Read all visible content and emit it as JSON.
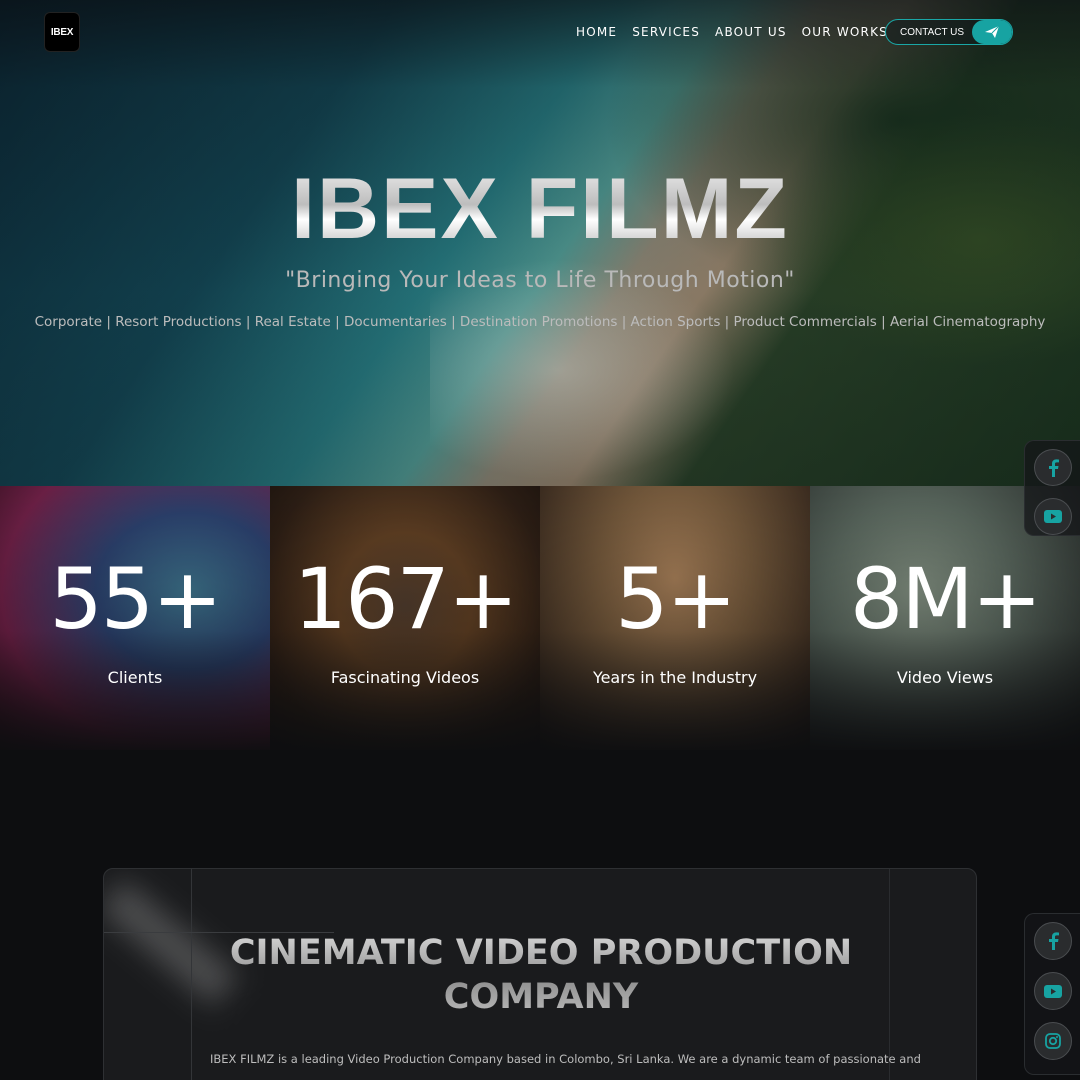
{
  "header": {
    "logo_text": "IBEX",
    "nav": [
      "HOME",
      "SERVICES",
      "ABOUT US",
      "OUR WORKS"
    ],
    "contact_label": "CONTACT US"
  },
  "hero": {
    "title": "IBEX FILMZ",
    "tagline": "\"Bringing Your Ideas to Life Through Motion\"",
    "services": "Corporate | Resort Productions | Real Estate | Documentaries | Destination Promotions | Action Sports | Product Commercials | Aerial Cinematography"
  },
  "stats": [
    {
      "value": "55+",
      "label": "Clients"
    },
    {
      "value": "167+",
      "label": "Fascinating Videos"
    },
    {
      "value": "5+",
      "label": "Years in the Industry"
    },
    {
      "value": "8M+",
      "label": "Video Views"
    }
  ],
  "social": {
    "top": [
      "facebook-icon",
      "youtube-icon"
    ],
    "bottom": [
      "facebook-icon",
      "youtube-icon",
      "instagram-icon"
    ]
  },
  "about": {
    "title_line1": "CINEMATIC VIDEO PRODUCTION",
    "title_line2": "COMPANY",
    "text": "IBEX FILMZ is a leading Video Production Company based in Colombo, Sri Lanka. We are a dynamic team of passionate and"
  },
  "colors": {
    "accent": "#17a3a2",
    "background": "#0d0e10"
  }
}
